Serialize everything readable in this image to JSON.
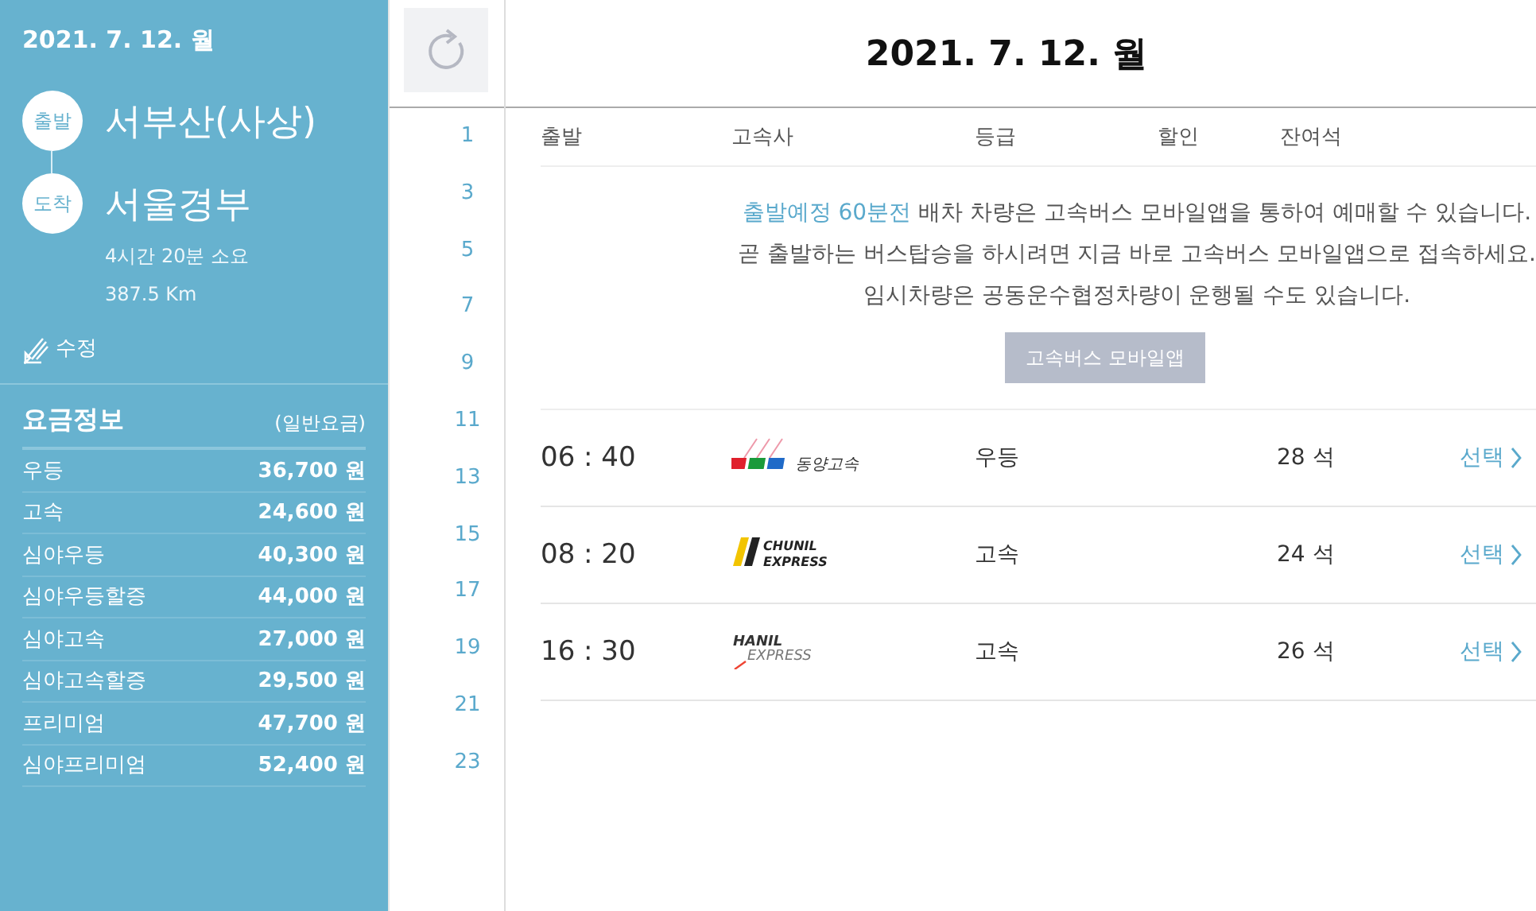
{
  "sidebar": {
    "date": "2021. 7. 12. 월",
    "route": [
      {
        "badge": "출발",
        "station": "서부산(사상)"
      },
      {
        "badge": "도착",
        "station": "서울경부"
      }
    ],
    "duration": "4시간 20분 소요",
    "distance": "387.5 Km",
    "edit_label": "수정",
    "fares": {
      "title": "요금정보",
      "note": "(일반요금)",
      "rows": [
        {
          "grade": "우등",
          "price": "36,700 원"
        },
        {
          "grade": "고속",
          "price": "24,600 원"
        },
        {
          "grade": "심야우등",
          "price": "40,300 원"
        },
        {
          "grade": "심야우등할증",
          "price": "44,000 원"
        },
        {
          "grade": "심야고속",
          "price": "27,000 원"
        },
        {
          "grade": "심야고속할증",
          "price": "29,500 원"
        },
        {
          "grade": "프리미엄",
          "price": "47,700 원"
        },
        {
          "grade": "심야프리미엄",
          "price": "52,400 원"
        }
      ]
    }
  },
  "hours": [
    "1",
    "3",
    "5",
    "7",
    "9",
    "11",
    "13",
    "15",
    "17",
    "19",
    "21",
    "23"
  ],
  "header": {
    "title": "2021. 7. 12. 월"
  },
  "table": {
    "columns": [
      "출발",
      "고속사",
      "등급",
      "할인",
      "잔여석"
    ],
    "notice": {
      "lines": [
        {
          "accent": "출발예정 60분전",
          "text": " 배차 차량은 고속버스 모바일앱을 통하여 예매할 수 있습니다."
        },
        {
          "text": "곧 출발하는 버스탑승을 하시려면 지금 바로 고속버스 모바일앱으로 접속하세요."
        },
        {
          "text": "임시차량은 공동운수협정차량이 운행될 수도 있습니다."
        }
      ],
      "button": "고속버스 모바일앱"
    },
    "rows": [
      {
        "time": "06 : 40",
        "company": {
          "kind": "dongyang",
          "logo_text": [
            "동양고속"
          ]
        },
        "grade": "우등",
        "seats": "28 석",
        "action": "선택"
      },
      {
        "time": "08 : 20",
        "company": {
          "kind": "chunil",
          "logo_text": [
            "CHUNIL",
            "EXPRESS"
          ]
        },
        "grade": "고속",
        "seats": "24 석",
        "action": "선택"
      },
      {
        "time": "16 : 30",
        "company": {
          "kind": "hanil",
          "logo_text": [
            "HANIL",
            "EXPRESS"
          ]
        },
        "grade": "고속",
        "seats": "26 석",
        "action": "선택"
      }
    ]
  }
}
